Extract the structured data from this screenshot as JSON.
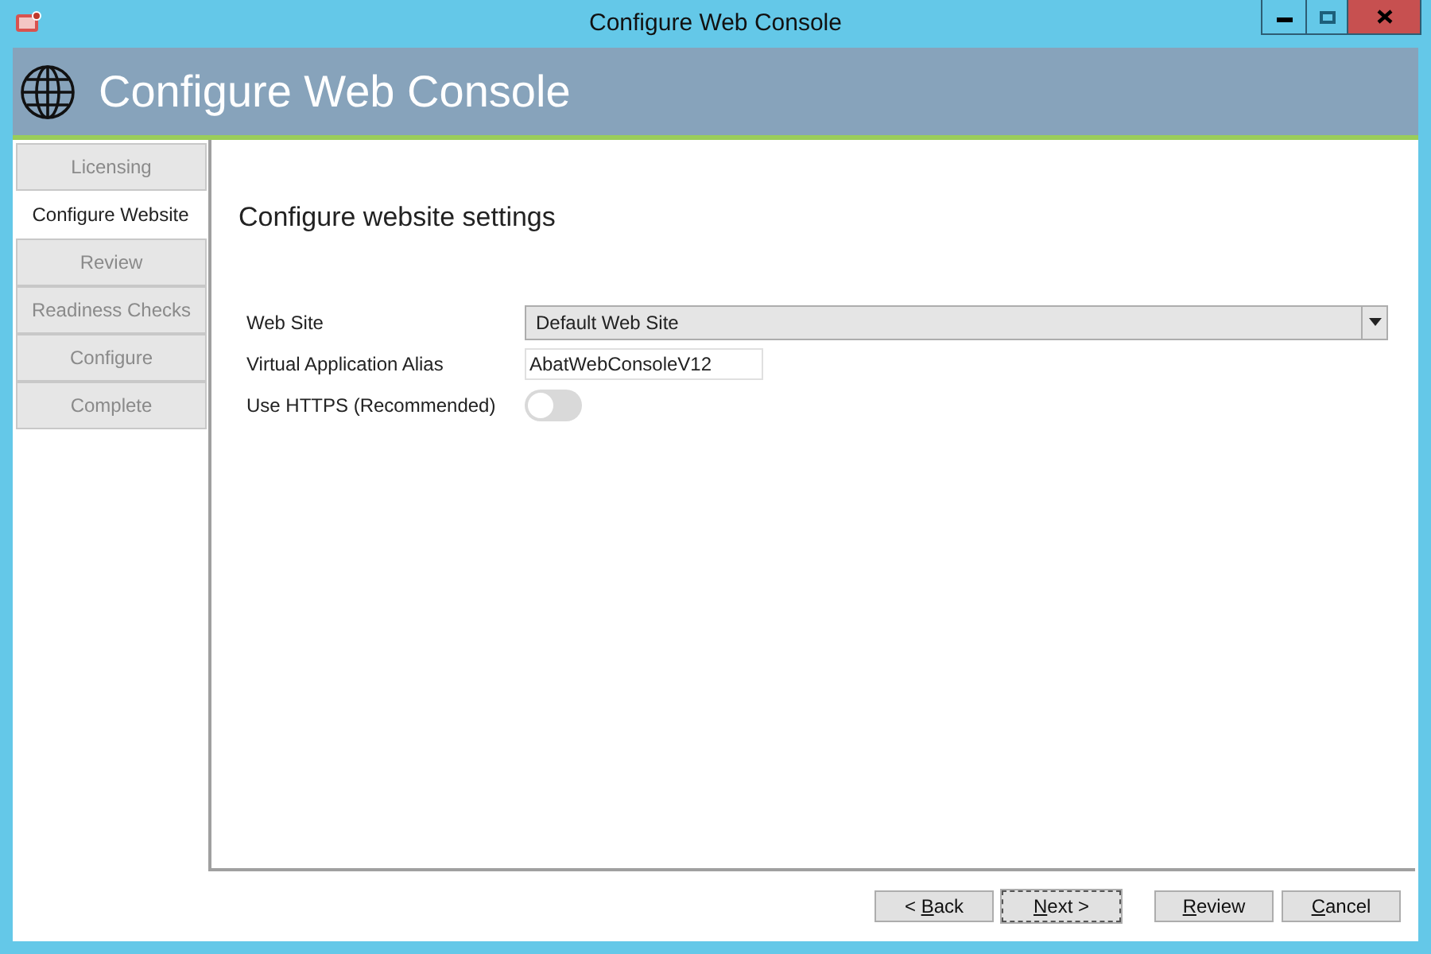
{
  "window": {
    "title": "Configure Web Console"
  },
  "header": {
    "title": "Configure Web Console"
  },
  "steps": [
    {
      "label": "Licensing",
      "selected": false
    },
    {
      "label": "Configure Website",
      "selected": true
    },
    {
      "label": "Review",
      "selected": false
    },
    {
      "label": "Readiness Checks",
      "selected": false
    },
    {
      "label": "Configure",
      "selected": false
    },
    {
      "label": "Complete",
      "selected": false
    }
  ],
  "page": {
    "heading": "Configure website settings",
    "fields": [
      {
        "kind": "dropdown",
        "label": "Web Site",
        "value": "Default Web Site"
      },
      {
        "kind": "text",
        "label": "Virtual Application Alias",
        "value": "AbatWebConsoleV12"
      },
      {
        "kind": "toggle",
        "label": "Use HTTPS (Recommended)",
        "on": false
      }
    ]
  },
  "buttons": [
    {
      "prefix": "< ",
      "key": "B",
      "rest": "ack",
      "focused": false
    },
    {
      "key": "N",
      "rest": "ext >",
      "focused": true
    },
    {
      "key": "R",
      "rest": "eview",
      "focused": false
    },
    {
      "key": "C",
      "rest": "ancel",
      "focused": false
    }
  ]
}
